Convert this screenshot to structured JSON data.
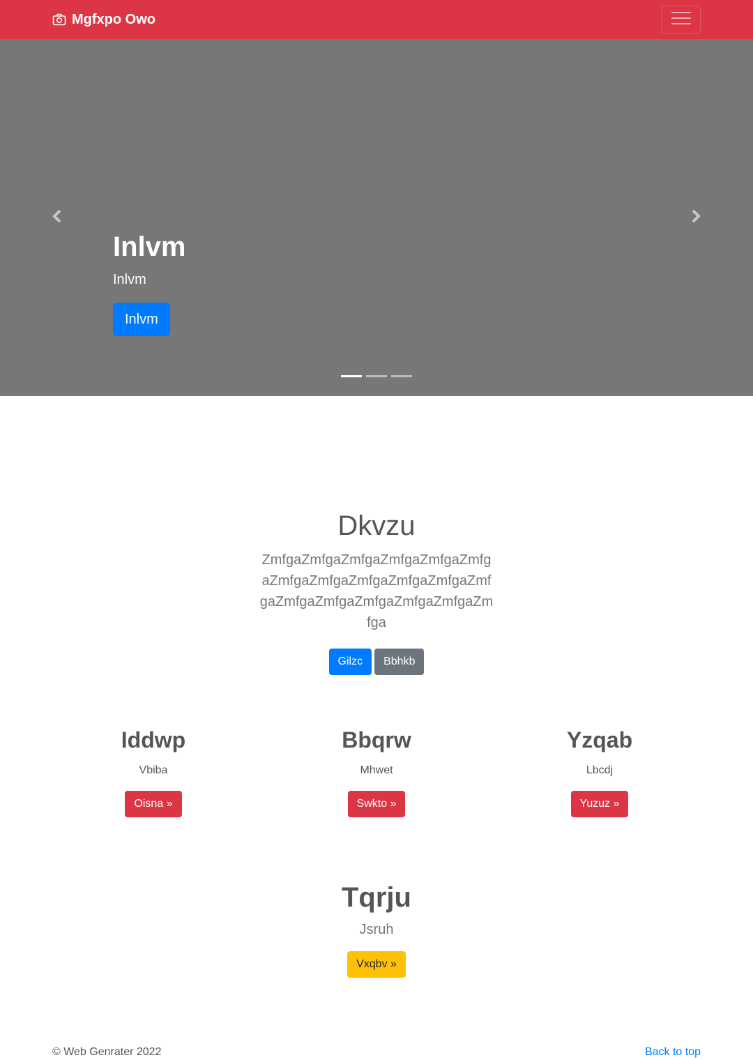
{
  "navbar": {
    "brand": "Mgfxpo Owo",
    "brand_icon": "camera-icon",
    "toggler_icon": "hamburger-menu-icon",
    "color": "#dc3545"
  },
  "carousel": {
    "title": "Inlvm",
    "text": "Inlvm",
    "button": "Inlvm",
    "prev_icon": "chevron-left-icon",
    "next_icon": "chevron-right-icon",
    "slide_count": 3,
    "active_slide": 1,
    "background": "#777777"
  },
  "intro": {
    "heading": "Dkvzu",
    "lead": "ZmfgaZmfgaZmfgaZmfgaZmfgaZmfgaZmfgaZmfgaZmfgaZmfgaZmfgaZmfgaZmfgaZmfgaZmfgaZmfgaZmfgaZmfga",
    "primary_button": "Gilzc",
    "secondary_button": "Bbhkb"
  },
  "columns": [
    {
      "heading": "Iddwp",
      "text": "Vbiba",
      "button": "Oisna »"
    },
    {
      "heading": "Bbqrw",
      "text": "Mhwet",
      "button": "Swkto »"
    },
    {
      "heading": "Yzqab",
      "text": "Lbcdj",
      "button": "Yuzuz »"
    }
  ],
  "featured": {
    "heading": "Tqrju",
    "text": "Jsruh",
    "button": "Vxqbv »"
  },
  "footer": {
    "copyright": "© Web Genrater 2022",
    "back_to_top": "Back to top"
  }
}
